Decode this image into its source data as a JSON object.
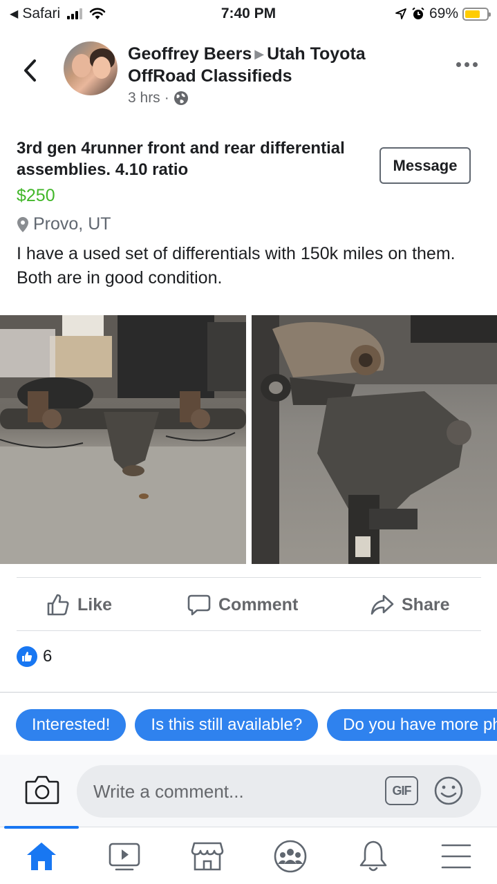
{
  "status_bar": {
    "back_app": "Safari",
    "time": "7:40 PM",
    "battery": "69%",
    "battery_level": 0.69
  },
  "header": {
    "author": "Geoffrey Beers",
    "group": "Utah Toyota OffRoad Classifieds",
    "time_ago": "3 hrs",
    "separator": "·"
  },
  "listing": {
    "title": "3rd gen 4runner front and rear differential assemblies. 4.10 ratio",
    "message_label": "Message",
    "price": "$250",
    "location": "Provo, UT",
    "description": "I have a used set of differentials with 150k miles on them. Both are in good condition."
  },
  "actions": {
    "like": "Like",
    "comment": "Comment",
    "share": "Share"
  },
  "reactions": {
    "count": "6"
  },
  "quick_replies": [
    "Interested!",
    "Is this still available?",
    "Do you have more photos?"
  ],
  "comment_bar": {
    "placeholder": "Write a comment...",
    "gif_label": "GIF"
  },
  "icons": {
    "home": "home-icon",
    "watch": "video-icon",
    "marketplace": "marketplace-icon",
    "groups": "groups-icon",
    "notifications": "bell-icon",
    "menu": "menu-icon"
  },
  "colors": {
    "brand_blue": "#1877f2",
    "price_green": "#42b72a",
    "chip_blue": "#2f82ee"
  }
}
